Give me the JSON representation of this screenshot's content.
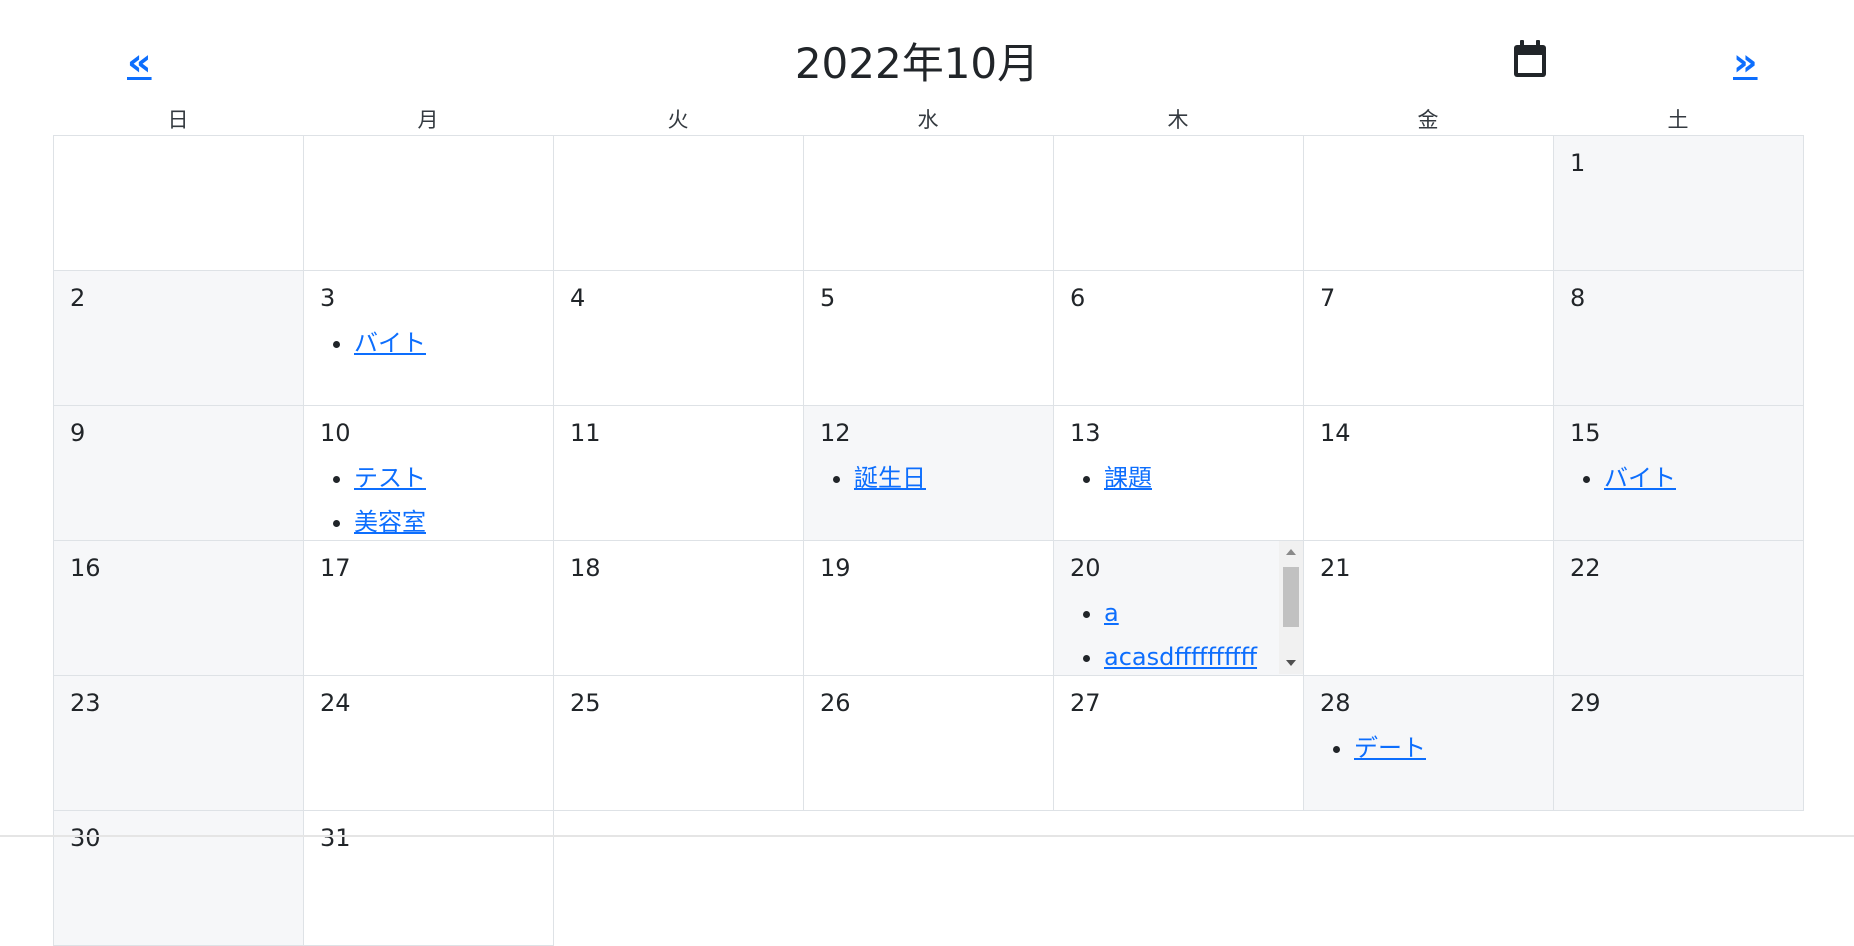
{
  "header": {
    "prev_label": "«",
    "next_label": "»",
    "title": "2022年10月",
    "calendar_icon": "calendar-icon"
  },
  "weekdays": [
    "日",
    "月",
    "火",
    "水",
    "木",
    "金",
    "土"
  ],
  "weeks": [
    [
      {
        "day": "",
        "gray": false,
        "events": []
      },
      {
        "day": "",
        "gray": false,
        "events": []
      },
      {
        "day": "",
        "gray": false,
        "events": []
      },
      {
        "day": "",
        "gray": false,
        "events": []
      },
      {
        "day": "",
        "gray": false,
        "events": []
      },
      {
        "day": "",
        "gray": false,
        "events": []
      },
      {
        "day": "1",
        "gray": true,
        "events": []
      }
    ],
    [
      {
        "day": "2",
        "gray": true,
        "events": []
      },
      {
        "day": "3",
        "gray": false,
        "events": [
          "バイト"
        ]
      },
      {
        "day": "4",
        "gray": false,
        "events": []
      },
      {
        "day": "5",
        "gray": false,
        "events": []
      },
      {
        "day": "6",
        "gray": false,
        "events": []
      },
      {
        "day": "7",
        "gray": false,
        "events": []
      },
      {
        "day": "8",
        "gray": true,
        "events": []
      }
    ],
    [
      {
        "day": "9",
        "gray": true,
        "events": []
      },
      {
        "day": "10",
        "gray": false,
        "events": [
          "テスト",
          "美容室"
        ]
      },
      {
        "day": "11",
        "gray": false,
        "events": []
      },
      {
        "day": "12",
        "gray": true,
        "events": [
          "誕生日"
        ]
      },
      {
        "day": "13",
        "gray": false,
        "events": [
          "課題"
        ]
      },
      {
        "day": "14",
        "gray": false,
        "events": []
      },
      {
        "day": "15",
        "gray": true,
        "events": [
          "バイト"
        ]
      }
    ],
    [
      {
        "day": "16",
        "gray": true,
        "events": []
      },
      {
        "day": "17",
        "gray": false,
        "events": []
      },
      {
        "day": "18",
        "gray": false,
        "events": []
      },
      {
        "day": "19",
        "gray": false,
        "events": []
      },
      {
        "day": "20",
        "gray": true,
        "events": [
          "a",
          "acasdffffffffff"
        ],
        "scroll": true
      },
      {
        "day": "21",
        "gray": false,
        "events": []
      },
      {
        "day": "22",
        "gray": true,
        "events": []
      }
    ],
    [
      {
        "day": "23",
        "gray": true,
        "events": []
      },
      {
        "day": "24",
        "gray": false,
        "events": []
      },
      {
        "day": "25",
        "gray": false,
        "events": []
      },
      {
        "day": "26",
        "gray": false,
        "events": []
      },
      {
        "day": "27",
        "gray": false,
        "events": []
      },
      {
        "day": "28",
        "gray": true,
        "events": [
          "デート"
        ]
      },
      {
        "day": "29",
        "gray": true,
        "events": []
      }
    ],
    [
      {
        "day": "30",
        "gray": true,
        "events": []
      },
      {
        "day": "31",
        "gray": false,
        "events": []
      }
    ]
  ]
}
